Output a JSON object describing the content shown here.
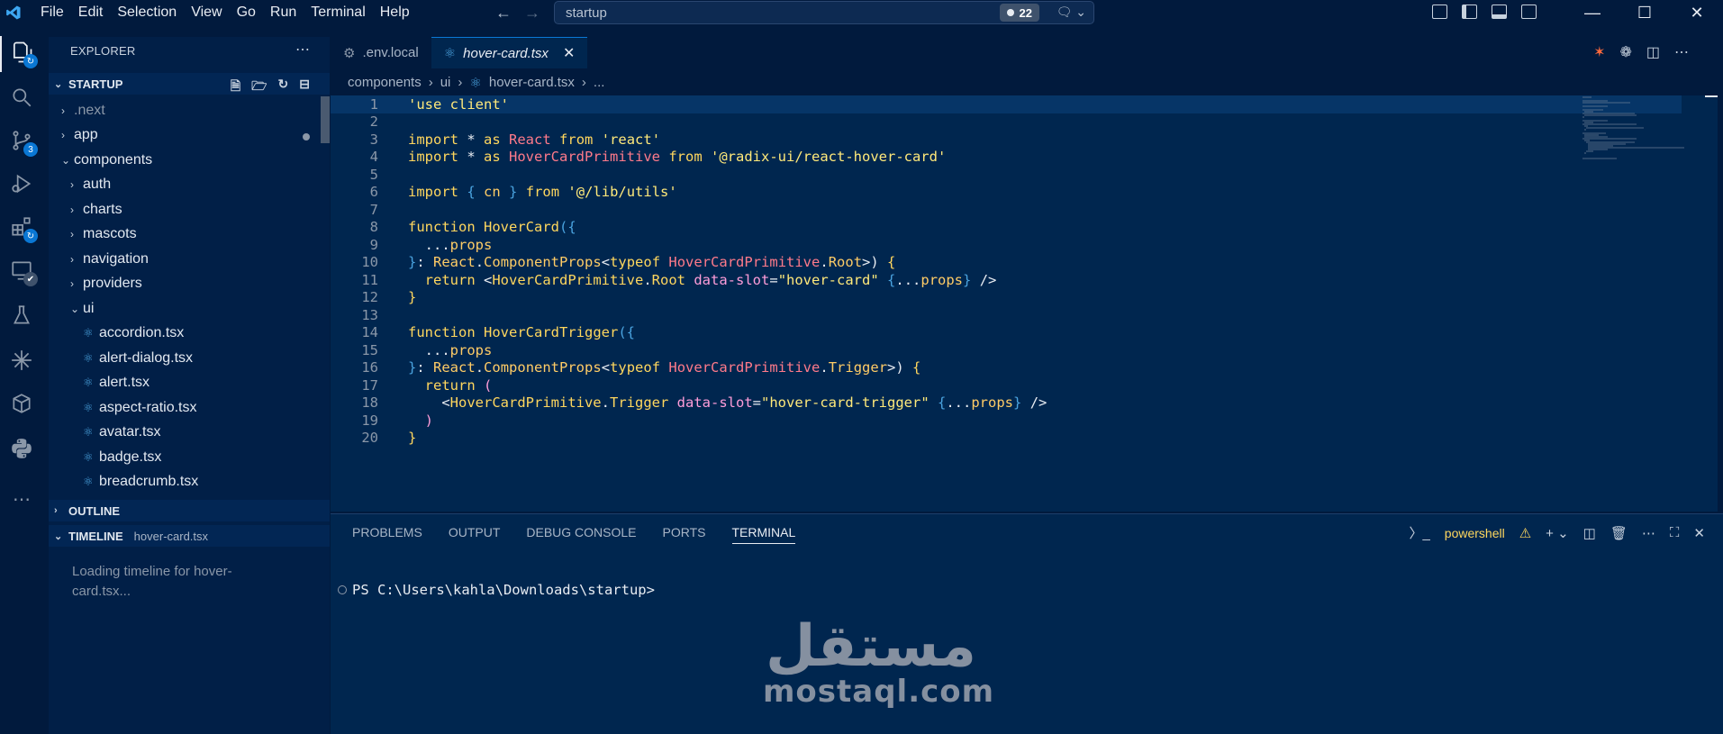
{
  "menu": [
    "File",
    "Edit",
    "Selection",
    "View",
    "Go",
    "Run",
    "Terminal",
    "Help"
  ],
  "command_center": {
    "text": "startup",
    "badge_count": "22"
  },
  "explorer": {
    "title": "EXPLORER",
    "project": "STARTUP"
  },
  "tree": [
    {
      "label": ".next",
      "type": "folder",
      "open": false,
      "depth": 0,
      "dim": true
    },
    {
      "label": "app",
      "type": "folder",
      "open": false,
      "depth": 0,
      "modified": true
    },
    {
      "label": "components",
      "type": "folder",
      "open": true,
      "depth": 0
    },
    {
      "label": "auth",
      "type": "folder",
      "open": false,
      "depth": 1
    },
    {
      "label": "charts",
      "type": "folder",
      "open": false,
      "depth": 1
    },
    {
      "label": "mascots",
      "type": "folder",
      "open": false,
      "depth": 1
    },
    {
      "label": "navigation",
      "type": "folder",
      "open": false,
      "depth": 1
    },
    {
      "label": "providers",
      "type": "folder",
      "open": false,
      "depth": 1
    },
    {
      "label": "ui",
      "type": "folder",
      "open": true,
      "depth": 1
    },
    {
      "label": "accordion.tsx",
      "type": "file",
      "depth": 2
    },
    {
      "label": "alert-dialog.tsx",
      "type": "file",
      "depth": 2
    },
    {
      "label": "alert.tsx",
      "type": "file",
      "depth": 2
    },
    {
      "label": "aspect-ratio.tsx",
      "type": "file",
      "depth": 2
    },
    {
      "label": "avatar.tsx",
      "type": "file",
      "depth": 2
    },
    {
      "label": "badge.tsx",
      "type": "file",
      "depth": 2
    },
    {
      "label": "breadcrumb.tsx",
      "type": "file",
      "depth": 2
    }
  ],
  "outline": {
    "label": "OUTLINE"
  },
  "timeline": {
    "label": "TIMELINE",
    "file": "hover-card.tsx",
    "loading": "Loading timeline for hover-card.tsx..."
  },
  "tabs": [
    {
      "label": ".env.local",
      "active": false
    },
    {
      "label": "hover-card.tsx",
      "active": true
    }
  ],
  "breadcrumb": [
    "components",
    "ui",
    "hover-card.tsx",
    "..."
  ],
  "code": [
    [
      [
        "str",
        "'use client'"
      ]
    ],
    [],
    [
      [
        "kw",
        "import"
      ],
      [
        "plain",
        " * "
      ],
      [
        "kw",
        "as"
      ],
      [
        "plain",
        " "
      ],
      [
        "type",
        "React"
      ],
      [
        "plain",
        " "
      ],
      [
        "kw",
        "from"
      ],
      [
        "plain",
        " "
      ],
      [
        "str",
        "'react'"
      ]
    ],
    [
      [
        "kw",
        "import"
      ],
      [
        "plain",
        " * "
      ],
      [
        "kw",
        "as"
      ],
      [
        "plain",
        " "
      ],
      [
        "type",
        "HoverCardPrimitive"
      ],
      [
        "plain",
        " "
      ],
      [
        "kw",
        "from"
      ],
      [
        "plain",
        " "
      ],
      [
        "str",
        "'@radix-ui/react-hover-card'"
      ]
    ],
    [],
    [
      [
        "kw",
        "import"
      ],
      [
        "plain",
        " "
      ],
      [
        "brace",
        "{"
      ],
      [
        "plain",
        " "
      ],
      [
        "prop",
        "cn"
      ],
      [
        "plain",
        " "
      ],
      [
        "brace",
        "}"
      ],
      [
        "plain",
        " "
      ],
      [
        "kw",
        "from"
      ],
      [
        "plain",
        " "
      ],
      [
        "str",
        "'@/lib/utils'"
      ]
    ],
    [],
    [
      [
        "kw",
        "function"
      ],
      [
        "plain",
        " "
      ],
      [
        "fn",
        "HoverCard"
      ],
      [
        "brace",
        "({"
      ]
    ],
    [
      [
        "plain",
        "  ..."
      ],
      [
        "prop",
        "props"
      ]
    ],
    [
      [
        "brace",
        "}"
      ],
      [
        "plain",
        ": "
      ],
      [
        "prop",
        "React"
      ],
      [
        "plain",
        "."
      ],
      [
        "prop",
        "ComponentProps"
      ],
      [
        "plain",
        "<"
      ],
      [
        "kw",
        "typeof"
      ],
      [
        "plain",
        " "
      ],
      [
        "type",
        "HoverCardPrimitive"
      ],
      [
        "plain",
        "."
      ],
      [
        "prop",
        "Root"
      ],
      [
        "plain",
        ">) "
      ],
      [
        "kw",
        "{"
      ]
    ],
    [
      [
        "plain",
        "  "
      ],
      [
        "kw",
        "return"
      ],
      [
        "plain",
        " <"
      ],
      [
        "fn",
        "HoverCardPrimitive"
      ],
      [
        "plain",
        "."
      ],
      [
        "fn",
        "Root"
      ],
      [
        "plain",
        " "
      ],
      [
        "attr",
        "data-slot"
      ],
      [
        "plain",
        "="
      ],
      [
        "str",
        "\"hover-card\""
      ],
      [
        "plain",
        " "
      ],
      [
        "brace",
        "{"
      ],
      [
        "plain",
        "..."
      ],
      [
        "prop",
        "props"
      ],
      [
        "brace",
        "}"
      ],
      [
        "plain",
        " />"
      ]
    ],
    [
      [
        "kw",
        "}"
      ]
    ],
    [],
    [
      [
        "kw",
        "function"
      ],
      [
        "plain",
        " "
      ],
      [
        "fn",
        "HoverCardTrigger"
      ],
      [
        "brace",
        "({"
      ]
    ],
    [
      [
        "plain",
        "  ..."
      ],
      [
        "prop",
        "props"
      ]
    ],
    [
      [
        "brace",
        "}"
      ],
      [
        "plain",
        ": "
      ],
      [
        "prop",
        "React"
      ],
      [
        "plain",
        "."
      ],
      [
        "prop",
        "ComponentProps"
      ],
      [
        "plain",
        "<"
      ],
      [
        "kw",
        "typeof"
      ],
      [
        "plain",
        " "
      ],
      [
        "type",
        "HoverCardPrimitive"
      ],
      [
        "plain",
        "."
      ],
      [
        "prop",
        "Trigger"
      ],
      [
        "plain",
        ">) "
      ],
      [
        "kw",
        "{"
      ]
    ],
    [
      [
        "plain",
        "  "
      ],
      [
        "kw",
        "return"
      ],
      [
        "plain",
        " "
      ],
      [
        "attr",
        "("
      ]
    ],
    [
      [
        "plain",
        "    <"
      ],
      [
        "fn",
        "HoverCardPrimitive"
      ],
      [
        "plain",
        "."
      ],
      [
        "fn",
        "Trigger"
      ],
      [
        "plain",
        " "
      ],
      [
        "attr",
        "data-slot"
      ],
      [
        "plain",
        "="
      ],
      [
        "str",
        "\"hover-card-trigger\""
      ],
      [
        "plain",
        " "
      ],
      [
        "brace",
        "{"
      ],
      [
        "plain",
        "..."
      ],
      [
        "prop",
        "props"
      ],
      [
        "brace",
        "}"
      ],
      [
        "plain",
        " />"
      ]
    ],
    [
      [
        "plain",
        "  "
      ],
      [
        "attr",
        ")"
      ]
    ],
    [
      [
        "kw",
        "}"
      ]
    ]
  ],
  "panel": {
    "tabs": [
      {
        "label": "PROBLEMS",
        "active": false
      },
      {
        "label": "OUTPUT",
        "active": false
      },
      {
        "label": "DEBUG CONSOLE",
        "active": false
      },
      {
        "label": "PORTS",
        "active": false
      },
      {
        "label": "TERMINAL",
        "active": true
      }
    ],
    "shell": "powershell",
    "prompt": "PS C:\\Users\\kahla\\Downloads\\startup>"
  },
  "watermark": {
    "arabic": "مستقل",
    "latin": "mostaql.com"
  },
  "scm_badge": "3",
  "colors": {
    "accent": "#0a77d4",
    "background": "#011a3d",
    "editor_bg": "#00264f"
  }
}
